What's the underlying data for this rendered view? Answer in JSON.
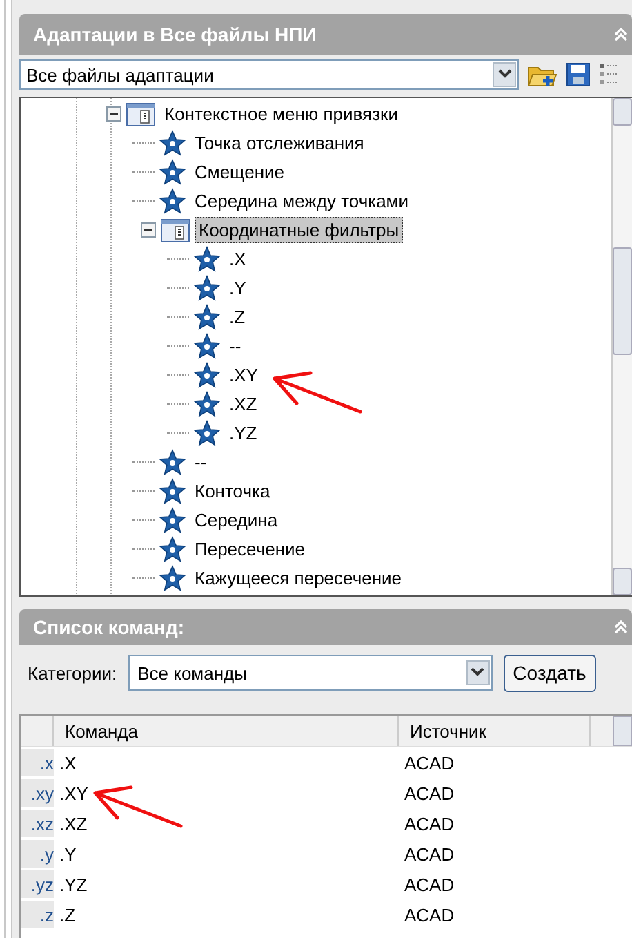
{
  "customizations_panel": {
    "title": "Адаптации в Все файлы НПИ",
    "file_selector": {
      "value": "Все файлы адаптации"
    },
    "tree": [
      {
        "label": "Контекстное меню привязки",
        "kind": "menu",
        "expanded": true,
        "selected": false,
        "marked": false,
        "children": [
          {
            "label": "Точка отслеживания",
            "kind": "command",
            "selected": false,
            "marked": false
          },
          {
            "label": "Смещение",
            "kind": "command",
            "selected": false,
            "marked": false
          },
          {
            "label": "Середина между точками",
            "kind": "command",
            "selected": false,
            "marked": false
          },
          {
            "label": "Координатные фильтры",
            "kind": "menu",
            "expanded": true,
            "selected": true,
            "marked": false,
            "children": [
              {
                "label": ".X",
                "kind": "command",
                "selected": false,
                "marked": false
              },
              {
                "label": ".Y",
                "kind": "command",
                "selected": false,
                "marked": false
              },
              {
                "label": ".Z",
                "kind": "command",
                "selected": false,
                "marked": false
              },
              {
                "label": "--",
                "kind": "command",
                "selected": false,
                "marked": false
              },
              {
                "label": ".XY",
                "kind": "command",
                "selected": false,
                "marked": true
              },
              {
                "label": ".XZ",
                "kind": "command",
                "selected": false,
                "marked": false
              },
              {
                "label": ".YZ",
                "kind": "command",
                "selected": false,
                "marked": false
              }
            ]
          },
          {
            "label": "--",
            "kind": "command",
            "selected": false,
            "marked": false
          },
          {
            "label": "Конточка",
            "kind": "command",
            "selected": false,
            "marked": false
          },
          {
            "label": "Середина",
            "kind": "command",
            "selected": false,
            "marked": false
          },
          {
            "label": "Пересечение",
            "kind": "command",
            "selected": false,
            "marked": false
          },
          {
            "label": "Кажущееся пересечение",
            "kind": "command",
            "selected": false,
            "marked": false
          }
        ]
      }
    ]
  },
  "command_list_panel": {
    "title": "Список команд:",
    "category_label": "Категории:",
    "category_selector": {
      "value": "Все команды"
    },
    "create_button": "Создать",
    "table": {
      "columns": [
        "Команда",
        "Источник"
      ],
      "rows": [
        {
          "icon_text": ".x",
          "command": ".X",
          "source": "ACAD",
          "marked": false
        },
        {
          "icon_text": ".xy",
          "command": ".XY",
          "source": "ACAD",
          "marked": true
        },
        {
          "icon_text": ".xz",
          "command": ".XZ",
          "source": "ACAD",
          "marked": false
        },
        {
          "icon_text": ".y",
          "command": ".Y",
          "source": "ACAD",
          "marked": false
        },
        {
          "icon_text": ".yz",
          "command": ".YZ",
          "source": "ACAD",
          "marked": false
        },
        {
          "icon_text": ".z",
          "command": ".Z",
          "source": "ACAD",
          "marked": false
        }
      ]
    }
  }
}
